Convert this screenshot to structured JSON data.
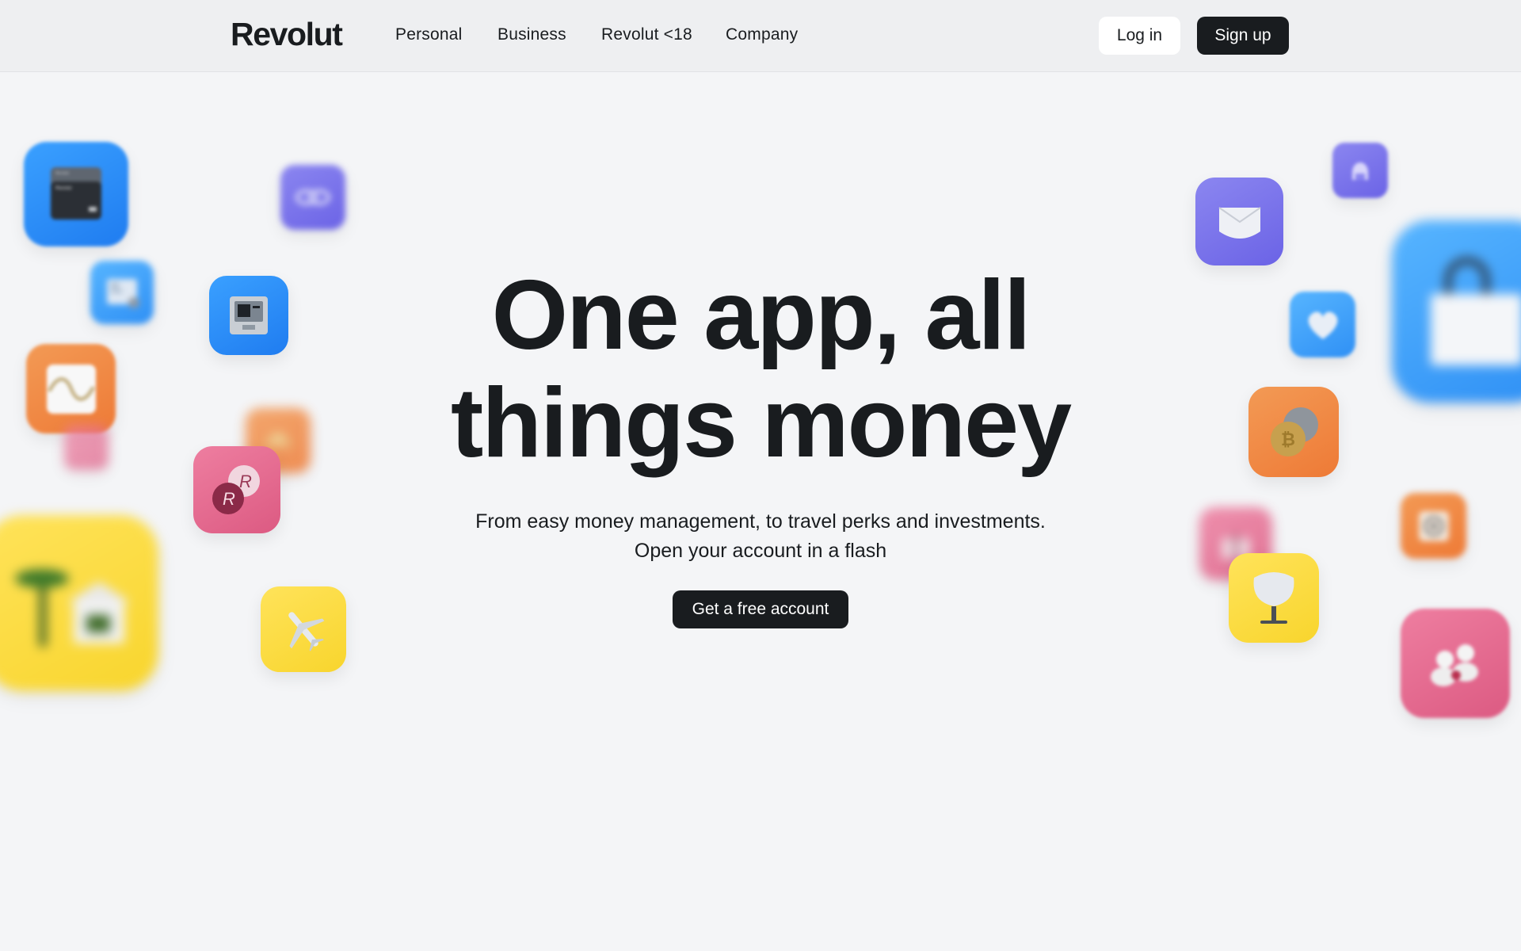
{
  "brand": "Revolut",
  "nav": {
    "links": [
      "Personal",
      "Business",
      "Revolut <18",
      "Company"
    ],
    "login": "Log in",
    "signup": "Sign up"
  },
  "hero": {
    "title_line1": "One app, all",
    "title_line2": "things money",
    "subtitle_line1": "From easy money management, to travel perks and investments.",
    "subtitle_line2": "Open your account in a flash",
    "cta": "Get a free account"
  },
  "card_brand": "Revolut",
  "colors": {
    "background": "#f4f5f7",
    "header": "#eeeff1",
    "dark": "#191c1f",
    "blue": "#2f90f5",
    "purple": "#6b63e6",
    "orange": "#ee7a36",
    "pink": "#dc5a82",
    "yellow": "#f8d52d"
  },
  "icons": [
    "cards-icon",
    "link-icon",
    "receipt-icon",
    "atm-icon",
    "chart-wave-icon",
    "gold-bars-icon",
    "rewards-icon",
    "vacation-home-icon",
    "airplane-icon",
    "envelope-icon",
    "lock-icon",
    "shopping-bag-icon",
    "heart-icon",
    "crypto-coins-icon",
    "gift-icon",
    "chair-icon",
    "target-icon",
    "people-icon"
  ]
}
